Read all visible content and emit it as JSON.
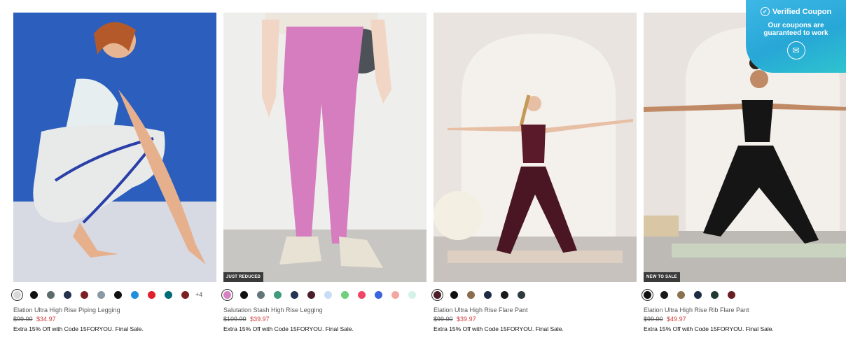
{
  "coupon": {
    "title": "Verified Coupon",
    "subtitle_line1": "Our coupons are",
    "subtitle_line2": "guaranteed to work",
    "icon": "chat-bubble-icon"
  },
  "products": [
    {
      "name": "Elation Ultra High Rise Piping Legging",
      "was_price": "$99.00",
      "sale_price": "$34.97",
      "promo": "Extra 15% Off with Code 15FORYOU. Final Sale.",
      "badge": "",
      "swatches": [
        "#d9d9d9",
        "#111111",
        "#5b6b6b",
        "#24324d",
        "#7a1f24",
        "#8a98a3",
        "#111111",
        "#1e8fdc",
        "#e01f2b",
        "#006b78",
        "#7b1f22"
      ],
      "more": "+4"
    },
    {
      "name": "Salutation Stash High Rise Legging",
      "was_price": "$109.00",
      "sale_price": "$39.97",
      "promo": "Extra 15% Off with Code 15FORYOU. Final Sale.",
      "badge": "JUST REDUCED",
      "swatches": [
        "#d681c2",
        "#111111",
        "#63757b",
        "#3f9b7c",
        "#253454",
        "#4a1e2c",
        "#c9dcf6",
        "#6fcf7e",
        "#f04565",
        "#3c63e0",
        "#f4a7a1",
        "#d5f2e8"
      ],
      "more": ""
    },
    {
      "name": "Elation Ultra High Rise Flare Pant",
      "was_price": "$99.00",
      "sale_price": "$39.97",
      "promo": "Extra 15% Off with Code 15FORYOU. Final Sale.",
      "badge": "",
      "swatches": [
        "#4a1d29",
        "#111111",
        "#8a6c4f",
        "#1f2a44",
        "#1b1b1b",
        "#2d3b3f"
      ],
      "more": ""
    },
    {
      "name": "Elation Ultra High Rise Rib Flare Pant",
      "was_price": "$99.00",
      "sale_price": "$49.97",
      "promo": "Extra 15% Off with Code 15FORYOU. Final Sale.",
      "badge": "NEW TO SALE",
      "swatches": [
        "#111111",
        "#1b1b1b",
        "#8a7250",
        "#1f2a44",
        "#1f3b34",
        "#6a1f24"
      ],
      "more": ""
    }
  ]
}
